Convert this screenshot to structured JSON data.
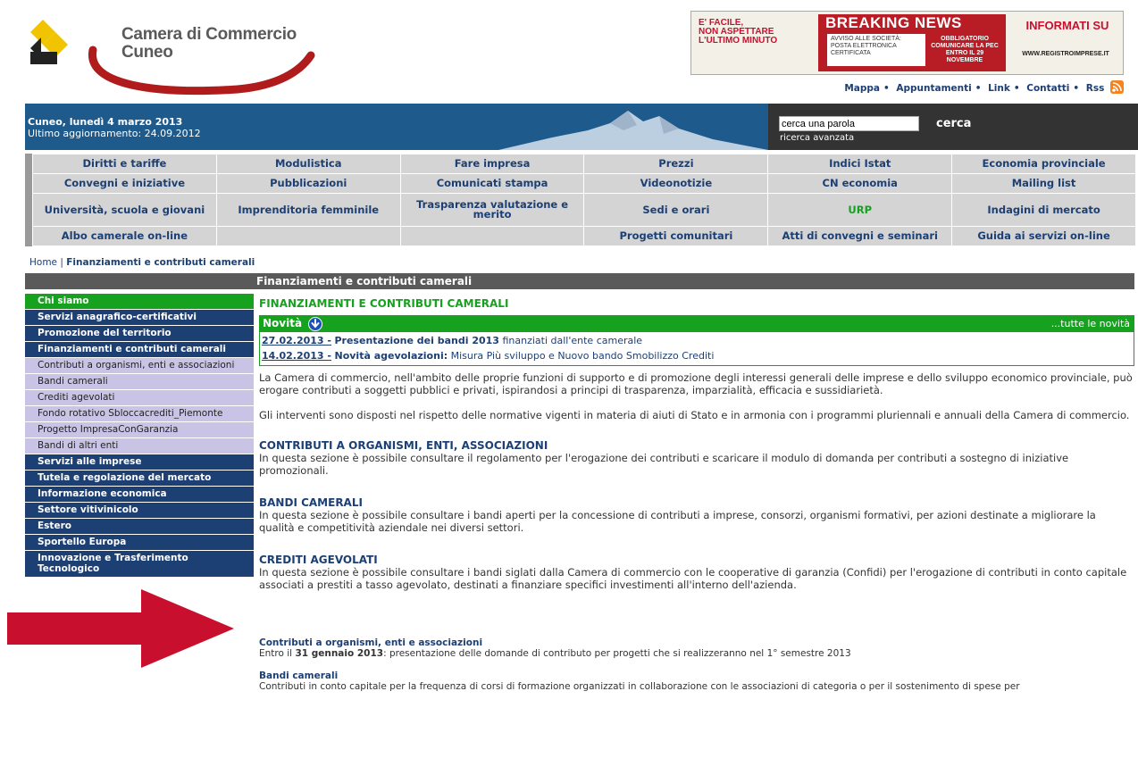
{
  "header": {
    "logo_line1": "Camera di Commercio",
    "logo_line2": "Cuneo"
  },
  "banner": {
    "left_text": "E' FACILE,\nNON ASPETTARE\nL'ULTIMO MINUTO",
    "title": "BREAKING NEWS",
    "sub": "AVVISO ALLE SOCIETÀ: POSTA ELETTRONICA CERTIFICATA",
    "red_box": "OBBLIGATORIO COMUNICARE LA PEC ENTRO IL 29 NOVEMBRE",
    "right_text": "INFORMATI SU",
    "url": "WWW.REGISTROIMPRESE.IT"
  },
  "top_links": [
    "Mappa",
    "Appuntamenti",
    "Link",
    "Contatti",
    "Rss"
  ],
  "band": {
    "date": "Cuneo, lunedì 4 marzo 2013",
    "updated": "Ultimo aggiornamento: 24.09.2012"
  },
  "search": {
    "value": "cerca una parola",
    "button": "cerca",
    "advanced": "ricerca avanzata"
  },
  "menu": {
    "row1": [
      "Diritti e tariffe",
      "Modulistica",
      "Fare impresa",
      "Prezzi",
      "Indici Istat",
      "Economia provinciale"
    ],
    "row2": [
      "Convegni e iniziative",
      "Pubblicazioni",
      "Comunicati stampa",
      "Videonotizie",
      "CN economia",
      "Mailing list"
    ],
    "row3": [
      "Università, scuola e giovani",
      "Imprenditoria femminile",
      "Trasparenza valutazione e merito",
      "Sedi e orari",
      "URP",
      "Indagini di mercato"
    ],
    "row4": [
      "Albo camerale on-line",
      "",
      "",
      "Progetti comunitari",
      "Atti di convegni e seminari",
      "Guida ai servizi on-line"
    ],
    "accent_color": "#16a11e"
  },
  "breadcrumb": {
    "home": "Home",
    "sep": "|",
    "current": "Finanziamenti e contributi camerali"
  },
  "section_bar": "Finanziamenti e contributi camerali",
  "sidebar": [
    "Chi siamo",
    "Servizi anagrafico-certificativi",
    "Promozione del territorio",
    "Finanziamenti e contributi camerali",
    "Contributi a organismi, enti e associazioni",
    "Bandi camerali",
    "Crediti agevolati",
    "Fondo rotativo Sbloccacrediti_Piemonte",
    "Progetto ImpresaConGaranzia",
    "Bandi di altri enti",
    "Servizi alle imprese",
    "Tutela e regolazione del mercato",
    "Informazione economica",
    "Settore vitivinicolo",
    "Estero",
    "Sportello Europa",
    "Innovazione e Trasferimento Tecnologico"
  ],
  "content": {
    "title": "FINANZIAMENTI E CONTRIBUTI CAMERALI",
    "novita": {
      "label": "Novità",
      "all": "...tutte le novità",
      "items": [
        {
          "date": "27.02.2013 -",
          "title": "Presentazione dei bandi 2013",
          "rest": "finanziati dall'ente camerale"
        },
        {
          "date": "14.02.2013 -",
          "title": "Novità agevolazioni:",
          "rest": "Misura Più sviluppo e Nuovo bando Smobilizzo Crediti"
        }
      ]
    },
    "intro1": "La Camera di commercio, nell'ambito delle proprie funzioni di supporto e di promozione degli interessi generali delle imprese e dello sviluppo economico provinciale, può erogare contributi a soggetti pubblici e privati, ispirandosi a principi di trasparenza, imparzialità, efficacia e sussidiarietà.",
    "intro2": "Gli interventi sono disposti nel rispetto delle normative vigenti in materia di aiuti di Stato e in armonia con i programmi pluriennali e annuali della Camera di commercio.",
    "sections": [
      {
        "title": "CONTRIBUTI A ORGANISMI, ENTI, ASSOCIAZIONI",
        "text": "In questa sezione è possibile consultare il regolamento  per l'erogazione dei contributi  e scaricare il modulo di domanda per contributi a sostegno di iniziative promozionali."
      },
      {
        "title": "BANDI CAMERALI",
        "text": "In questa sezione è possibile consultare i bandi aperti per la concessione di contributi a imprese, consorzi, organismi formativi, per azioni destinate a migliorare la qualità e competitività aziendale nei diversi settori."
      },
      {
        "title": "CREDITI AGEVOLATI",
        "text": "In questa sezione è possibile consultare i bandi siglati dalla Camera di commercio con le cooperative di garanzia (Confidi) per l'erogazione di contributi in conto capitale associati a prestiti a tasso agevolato, destinati a finanziare specifici investimenti all'interno dell'azienda."
      }
    ],
    "news": [
      {
        "title": "Contributi a organismi, enti e associazioni",
        "pre": "Entro il ",
        "bold": "31 gennaio 2013",
        "post": ": presentazione delle domande di contributo per progetti che si realizzeranno nel 1° semestre 2013"
      },
      {
        "title": "Bandi camerali",
        "text": "Contributi in conto capitale per la frequenza di corsi di formazione organizzati in collaborazione con le associazioni di categoria o per il sostenimento di spese per"
      }
    ]
  },
  "colors": {
    "navy": "#1c3f74",
    "green": "#16a11e",
    "band_blue": "#1e5b8c",
    "arrow_red": "#c8102e",
    "logo_red": "#b01c1c",
    "logo_yellow": "#f0c400"
  }
}
